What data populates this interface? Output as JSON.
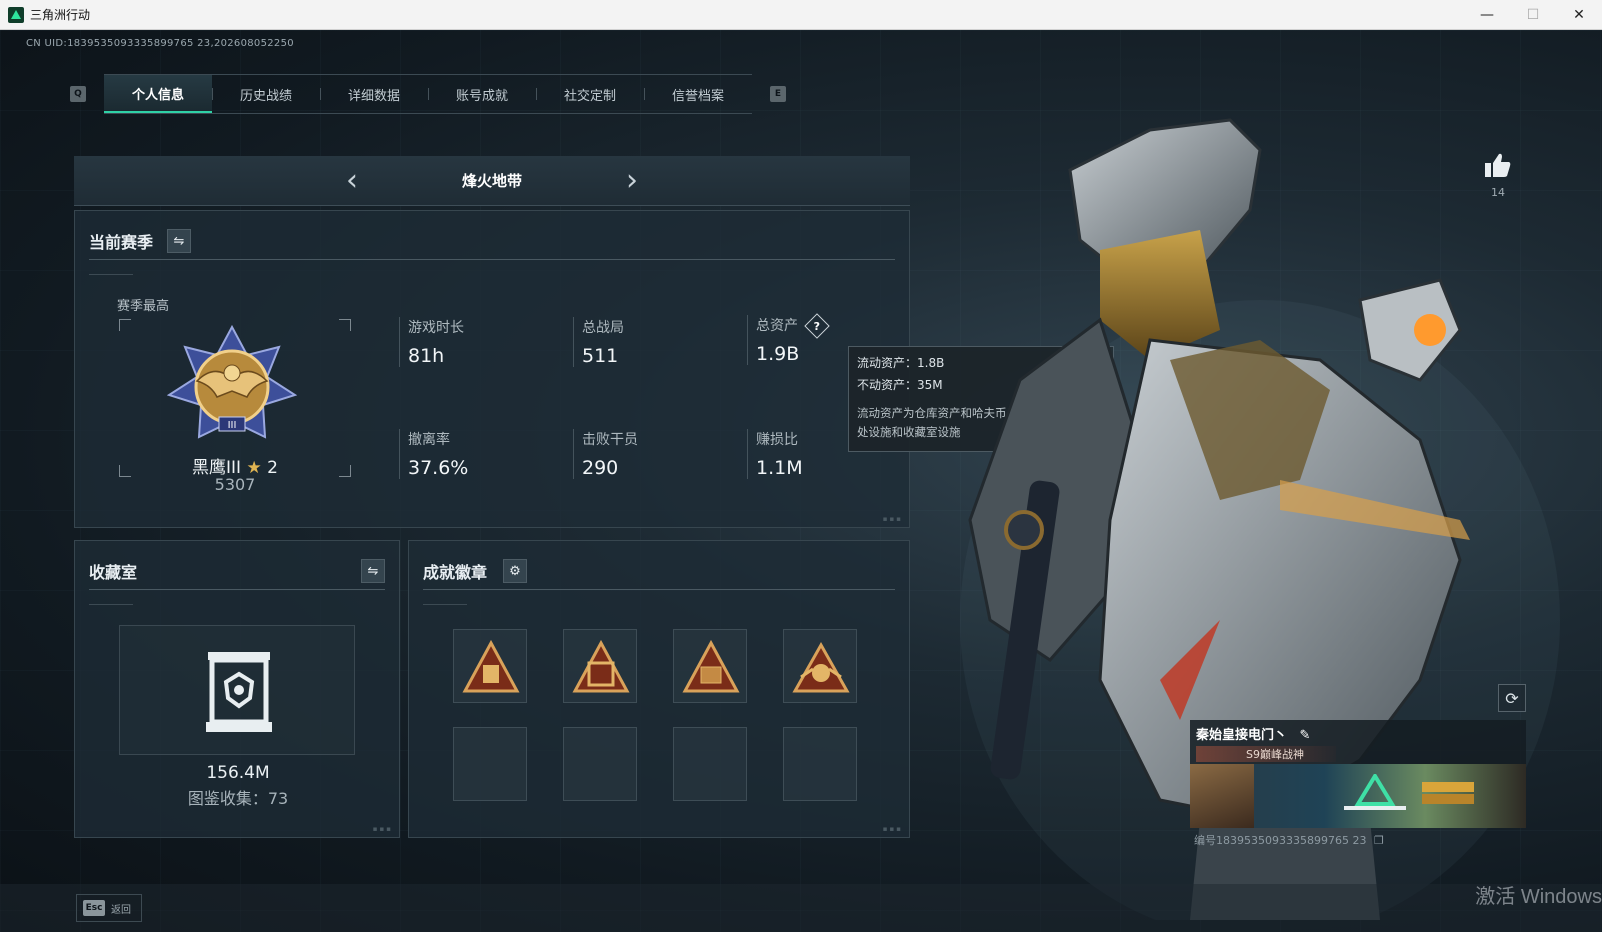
{
  "window": {
    "title": "三角洲行动",
    "minimize": "—",
    "maximize": "☐",
    "close": "✕"
  },
  "uid": "CN UID:1839535093335899765 23,202608052250",
  "ghost_title": "",
  "tabs": {
    "prev_key": "Q",
    "next_key": "E",
    "items": [
      {
        "label": "个人信息",
        "active": true
      },
      {
        "label": "历史战绩",
        "active": false
      },
      {
        "label": "详细数据",
        "active": false
      },
      {
        "label": "账号成就",
        "active": false
      },
      {
        "label": "社交定制",
        "active": false
      },
      {
        "label": "信誉档案",
        "active": false
      }
    ]
  },
  "mode": {
    "title": "烽火地带",
    "prev": "‹",
    "next": "›"
  },
  "season": {
    "title": "当前赛季",
    "swap_icon": "⇋",
    "best_label": "赛季最高",
    "rank_name": "黑鹰III",
    "rank_stars": "2",
    "rank_score": "5307",
    "stats": [
      {
        "label": "游戏时长",
        "value": "81h"
      },
      {
        "label": "总战局",
        "value": "511"
      },
      {
        "label": "总资产",
        "value": "1.9B",
        "help": "?"
      },
      {
        "label": "撤离率",
        "value": "37.6%"
      },
      {
        "label": "击败干员",
        "value": "290"
      },
      {
        "label": "赚损比",
        "value": "1.1M"
      }
    ]
  },
  "tooltip": {
    "liquid": "流动资产：1.8B",
    "fixed": "不动资产：35M",
    "desc": "流动资产为仓库资产和哈夫币，不动资产为特勤处设施和收藏室设施"
  },
  "collection": {
    "title": "收藏室",
    "swap_icon": "⇋",
    "value": "156.4M",
    "count": "图鉴收集：73"
  },
  "badges": {
    "title": "成就徽章",
    "gear_icon": "⚙"
  },
  "like": {
    "count": "14"
  },
  "card": {
    "name": "秦始皇接电门丶",
    "subtitle": "S9巅峰战神",
    "id": "编号1839535093335899765 23"
  },
  "bottom": {
    "esc_key": "Esc",
    "esc_label": "返回"
  },
  "watermark": "激活 Windows",
  "colors": {
    "accent": "#2fd1a6",
    "gold": "#e0b552",
    "panel": "#1e2c36"
  }
}
